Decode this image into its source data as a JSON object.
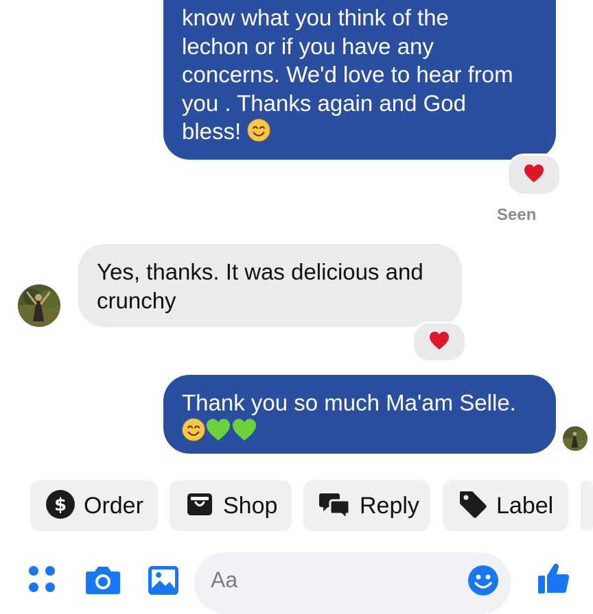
{
  "messages": [
    {
      "direction": "outgoing",
      "lines": [
        "know what you think of the",
        "lechon or if you have any",
        "concerns. We'd love to hear from",
        "you . Thanks again and God",
        "bless!"
      ],
      "trailing_emoji": "smiling-face-icon",
      "reaction": "red-heart"
    },
    {
      "direction": "incoming",
      "lines": [
        "Yes, thanks. It was delicious and",
        "crunchy"
      ],
      "reaction": "red-heart"
    },
    {
      "direction": "outgoing",
      "lines": [
        "Thank you so much Ma'am Selle."
      ],
      "emojis": [
        "smiling-face-icon",
        "green-heart-icon",
        "green-heart-icon"
      ]
    }
  ],
  "status": {
    "seen": "Seen"
  },
  "quick_replies": [
    {
      "label": "Order",
      "icon": "dollar-circle-icon"
    },
    {
      "label": "Shop",
      "icon": "shopping-bag-icon"
    },
    {
      "label": "Reply",
      "icon": "speech-bubbles-icon"
    },
    {
      "label": "Label",
      "icon": "tag-icon"
    }
  ],
  "composer": {
    "placeholder": "Aa",
    "icons": [
      "apps-icon",
      "camera-icon",
      "gallery-icon",
      "emoji-icon",
      "thumbs-up-icon"
    ]
  },
  "colors": {
    "outgoing_bubble": "#2a4fa1",
    "incoming_bubble": "#ebebeb",
    "accent_blue": "#1877f2",
    "heart_red": "#e0162b",
    "heart_green": "#6cd13a"
  }
}
